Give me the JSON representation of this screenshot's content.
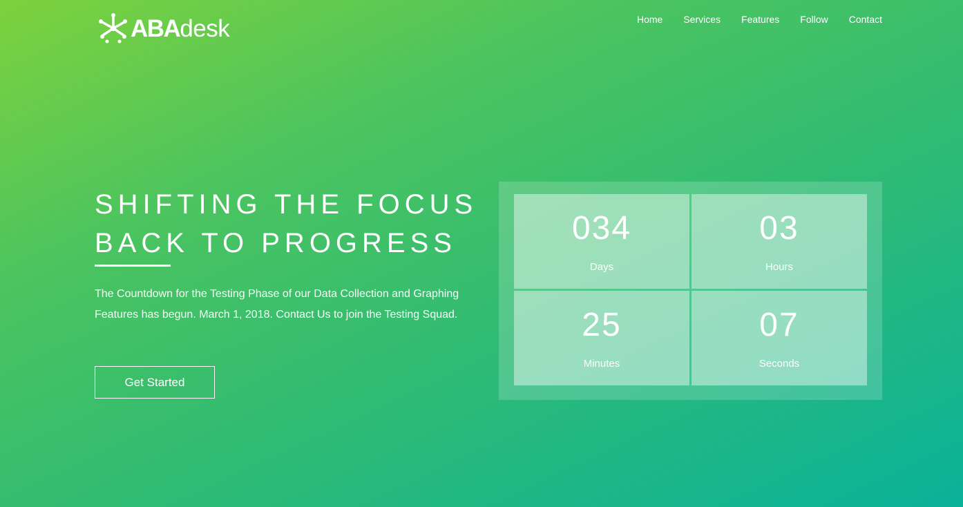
{
  "brand": {
    "bold": "ABA",
    "light": "desk"
  },
  "nav": {
    "items": [
      "Home",
      "Services",
      "Features",
      "Follow",
      "Contact"
    ]
  },
  "hero": {
    "title_line1": "SHIFTING THE FOCUS",
    "title_line2": "BACK TO PROGRESS",
    "description": "The Countdown for the Testing Phase of our Data Collection and Graphing Features has begun. March 1, 2018. Contact Us to join the Testing Squad.",
    "cta_label": "Get Started"
  },
  "countdown": {
    "days": {
      "value": "034",
      "label": "Days"
    },
    "hours": {
      "value": "03",
      "label": "Hours"
    },
    "minutes": {
      "value": "25",
      "label": "Minutes"
    },
    "seconds": {
      "value": "07",
      "label": "Seconds"
    }
  },
  "colors": {
    "gradient_start": "#7dd23d",
    "gradient_end": "#0ab29a",
    "text": "#ffffff"
  }
}
